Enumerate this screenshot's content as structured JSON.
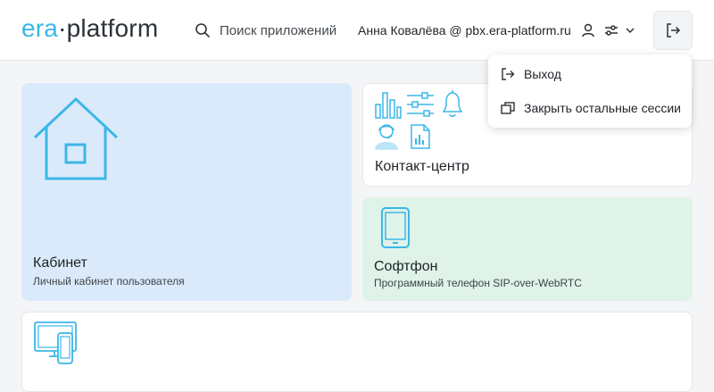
{
  "header": {
    "logo": {
      "part1": "era",
      "separator": "·",
      "part2": "platform"
    },
    "search_label": "Поиск приложений",
    "user_label": "Анна Ковалёва @ pbx.era-platform.ru",
    "icons": {
      "search": "search-icon",
      "user": "user-icon",
      "settings": "sliders-icon",
      "chevron": "chevron-down-icon",
      "logout": "logout-icon"
    }
  },
  "dropdown": {
    "items": [
      {
        "label": "Выход",
        "icon": "logout-icon"
      },
      {
        "label": "Закрыть остальные сессии",
        "icon": "windows-icon"
      }
    ]
  },
  "cards": {
    "cabinet": {
      "title": "Кабинет",
      "subtitle": "Личный кабинет пользователя",
      "icon": "house-icon"
    },
    "contact_center": {
      "title": "Контакт-центр",
      "icons": [
        "bar-chart-icon",
        "sliders-icon",
        "bell-icon",
        "operator-icon",
        "report-icon"
      ]
    },
    "softphone": {
      "title": "Софтфон",
      "subtitle": "Программный телефон SIP-over-WebRTC",
      "icon": "phone-icon"
    },
    "bottom": {
      "icon": "devices-icon"
    }
  },
  "colors": {
    "accent": "#3bb7e8",
    "cabinet_bg": "#dbeafb",
    "softphone_bg": "#dff3e8",
    "page_bg": "#f4f5f7"
  }
}
